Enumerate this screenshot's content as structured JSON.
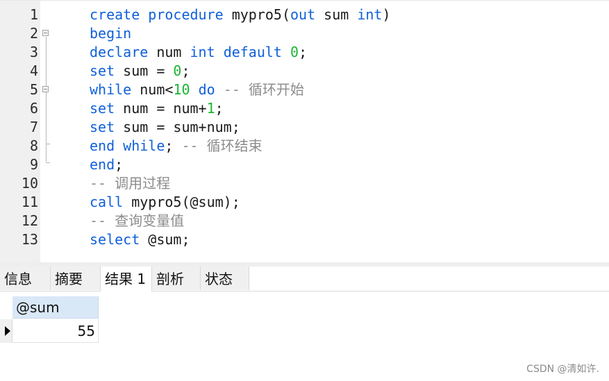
{
  "editor": {
    "lines": [
      {
        "n": "1"
      },
      {
        "n": "2"
      },
      {
        "n": "3"
      },
      {
        "n": "4"
      },
      {
        "n": "5"
      },
      {
        "n": "6"
      },
      {
        "n": "7"
      },
      {
        "n": "8"
      },
      {
        "n": "9"
      },
      {
        "n": "10"
      },
      {
        "n": "11"
      },
      {
        "n": "12"
      },
      {
        "n": "13"
      }
    ],
    "tokens": {
      "l1": [
        "create",
        "procedure",
        " mypro5(",
        "out",
        " sum ",
        "int",
        ")"
      ],
      "l2": [
        "begin"
      ],
      "l3": [
        "declare",
        " num ",
        "int",
        "default",
        "0",
        ";"
      ],
      "l4": [
        "set",
        " sum = ",
        "0",
        ";"
      ],
      "l5": [
        "while",
        " num<",
        "10",
        "do",
        "-- 循环开始"
      ],
      "l6": [
        "set",
        " num = num+",
        "1",
        ";"
      ],
      "l7": [
        "set",
        " sum = sum+num;"
      ],
      "l8": [
        "end",
        "while",
        "; ",
        "-- 循环结束"
      ],
      "l9": [
        "end",
        ";"
      ],
      "l10": [
        "-- 调用过程"
      ],
      "l11": [
        "call",
        " mypro5(@sum);"
      ],
      "l12": [
        "-- 查询变量值"
      ],
      "l13": [
        "select",
        " @sum;"
      ]
    },
    "colors": {
      "keyword": "#1060d8",
      "number": "#19b531",
      "comment": "#8c8c8c"
    }
  },
  "tabs": [
    {
      "label": "信息"
    },
    {
      "label": "摘要"
    },
    {
      "label": "结果 1",
      "active": true
    },
    {
      "label": "剖析"
    },
    {
      "label": "状态"
    }
  ],
  "result": {
    "columns": [
      "@sum"
    ],
    "rows": [
      [
        "55"
      ]
    ]
  },
  "watermark": "CSDN @清如许."
}
